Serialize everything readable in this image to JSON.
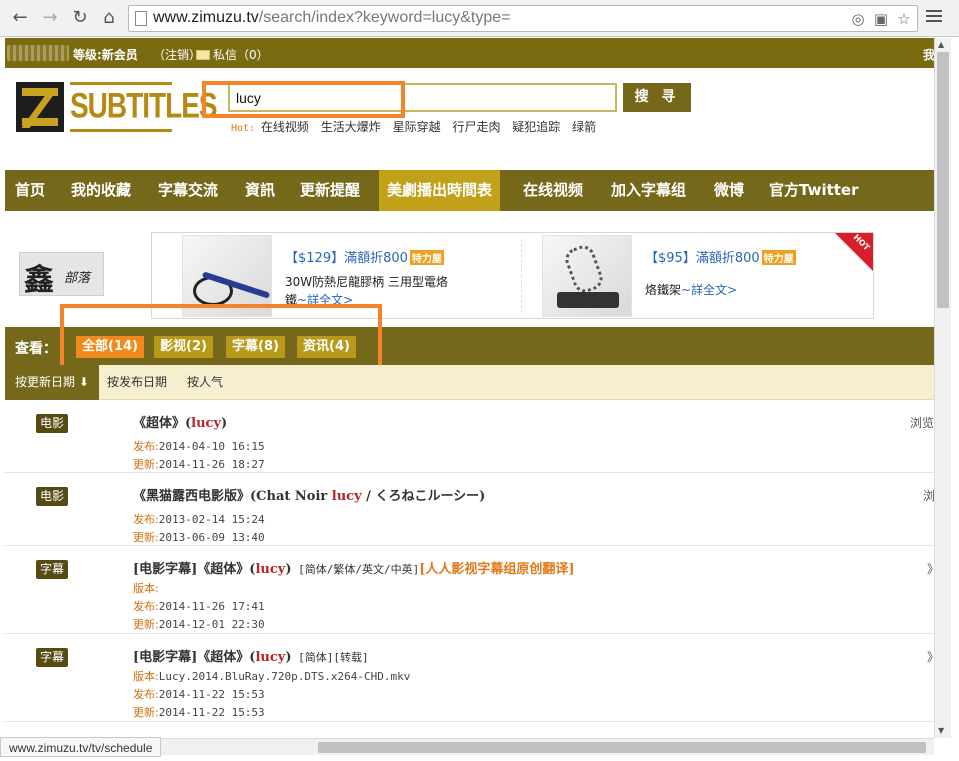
{
  "browser": {
    "url_host": "www.zimuzu.tv",
    "url_path": "/search/index?keyword=lucy&type=",
    "status_text": "www.zimuzu.tv/tv/schedule"
  },
  "topbar": {
    "level": "等级:新会员",
    "logout": "（注销）",
    "messages": "私信（0）",
    "right_char": "我"
  },
  "logo": {
    "text": "SUBTITLES"
  },
  "search": {
    "value": "lucy",
    "button": "搜 寻",
    "hot_label": "Hot:",
    "hot_items": [
      "在线视频",
      "生活大爆炸",
      "星际穿越",
      "行尸走肉",
      "疑犯追踪",
      "绿箭"
    ]
  },
  "nav": {
    "items": [
      "首页",
      "我的收藏",
      "字幕交流",
      "資訊",
      "更新提醒",
      "美劇播出時間表",
      "在线视频",
      "加入字幕组",
      "微博",
      "官方Twitter"
    ],
    "active_index": 5
  },
  "ads": {
    "stamp_big": "鑫",
    "stamp_small": "部落",
    "left": {
      "price": "【$129】滿額折800",
      "badge": "特力屋",
      "desc": "30W防熱尼龍膠柄 三用型電烙",
      "desc2": "鐵",
      "more": "~詳全文>"
    },
    "right": {
      "price": "【$95】滿額折800",
      "badge": "特力屋",
      "desc": "烙鐵架",
      "more": "~詳全文>",
      "hot": "HOT"
    }
  },
  "filter": {
    "label": "查看：",
    "chips": [
      "全部(14)",
      "影视(2)",
      "字幕(8)",
      "资讯(4)"
    ],
    "active_index": 0
  },
  "sort": {
    "items": [
      "按更新日期 ⬇",
      "按发布日期",
      "按人气"
    ],
    "active_index": 0
  },
  "results": [
    {
      "tag": "电影",
      "pre": "《超体》(",
      "kw": "lucy",
      "post": ")",
      "extra": "",
      "org": "",
      "version": "",
      "published": "2014-04-10 16:15",
      "updated": "2014-11-26 18:27",
      "right": "浏览"
    },
    {
      "tag": "电影",
      "pre": "《黑猫露西电影版》(Chat Noir ",
      "kw": "lucy",
      "post": " / くろねこルーシー)",
      "extra": "",
      "org": "",
      "version": "",
      "published": "2013-02-14 15:24",
      "updated": "2013-06-09 13:40",
      "right": "浏"
    },
    {
      "tag": "字幕",
      "pre": "[电影字幕]《超体》(",
      "kw": "lucy",
      "post": ")",
      "extra": " [简体/繁体/英文/中英]",
      "org": "[人人影视字幕组原创翻译]",
      "version": "",
      "published": "2014-11-26 17:41",
      "updated": "2014-12-01 22:30",
      "right": "》"
    },
    {
      "tag": "字幕",
      "pre": "[电影字幕]《超体》(",
      "kw": "lucy",
      "post": ")",
      "extra": " [简体][转载]",
      "org": "",
      "version": "Lucy.2014.BluRay.720p.DTS.x264-CHD.mkv",
      "published": "2014-11-22 15:53",
      "updated": "2014-11-22 15:53",
      "right": "》"
    }
  ],
  "labels": {
    "version": "版本:",
    "published": "发布:",
    "updated": "更新:"
  }
}
